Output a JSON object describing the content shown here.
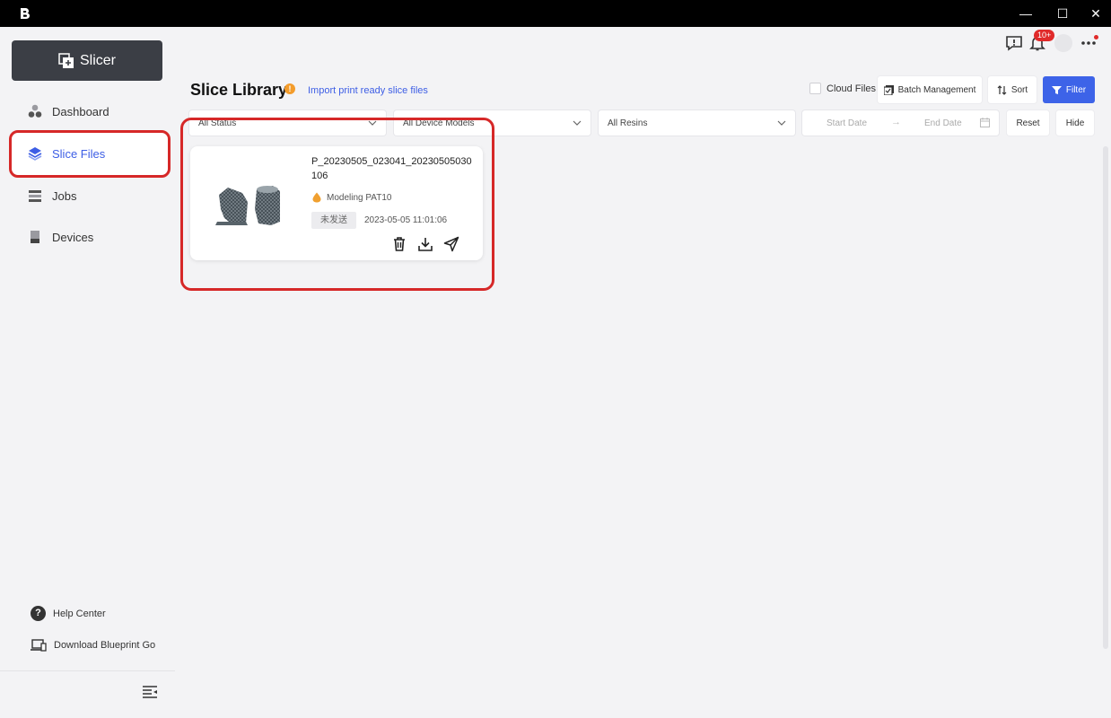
{
  "sidebar": {
    "slicer_label": "Slicer",
    "items": [
      {
        "label": "Dashboard",
        "icon": "dashboard-icon"
      },
      {
        "label": "Slice Files",
        "icon": "layers-icon"
      },
      {
        "label": "Jobs",
        "icon": "jobs-icon"
      },
      {
        "label": "Devices",
        "icon": "printer-icon"
      }
    ],
    "help_center": "Help Center",
    "download_go": "Download Blueprint Go"
  },
  "header": {
    "notification_count": "10+"
  },
  "library": {
    "title": "Slice Library",
    "import_link": "Import print ready slice files",
    "cloud_files": "Cloud Files",
    "batch_management": "Batch Management",
    "sort": "Sort",
    "filter": "Filter"
  },
  "filters": {
    "status": "All Status",
    "device_models": "All Device Models",
    "resins": "All Resins",
    "start_date": "Start Date",
    "end_date": "End Date",
    "reset": "Reset",
    "hide": "Hide"
  },
  "cards": [
    {
      "file_name": "P_20230505_023041_20230505030106",
      "resin": "Modeling PAT10",
      "status": "未发送",
      "date": "2023-05-05 11:01:06"
    }
  ],
  "colors": {
    "accent": "#3d63e8",
    "highlight": "#d62828",
    "sidebar_button": "#3b3e45",
    "info": "#f39c2b"
  }
}
